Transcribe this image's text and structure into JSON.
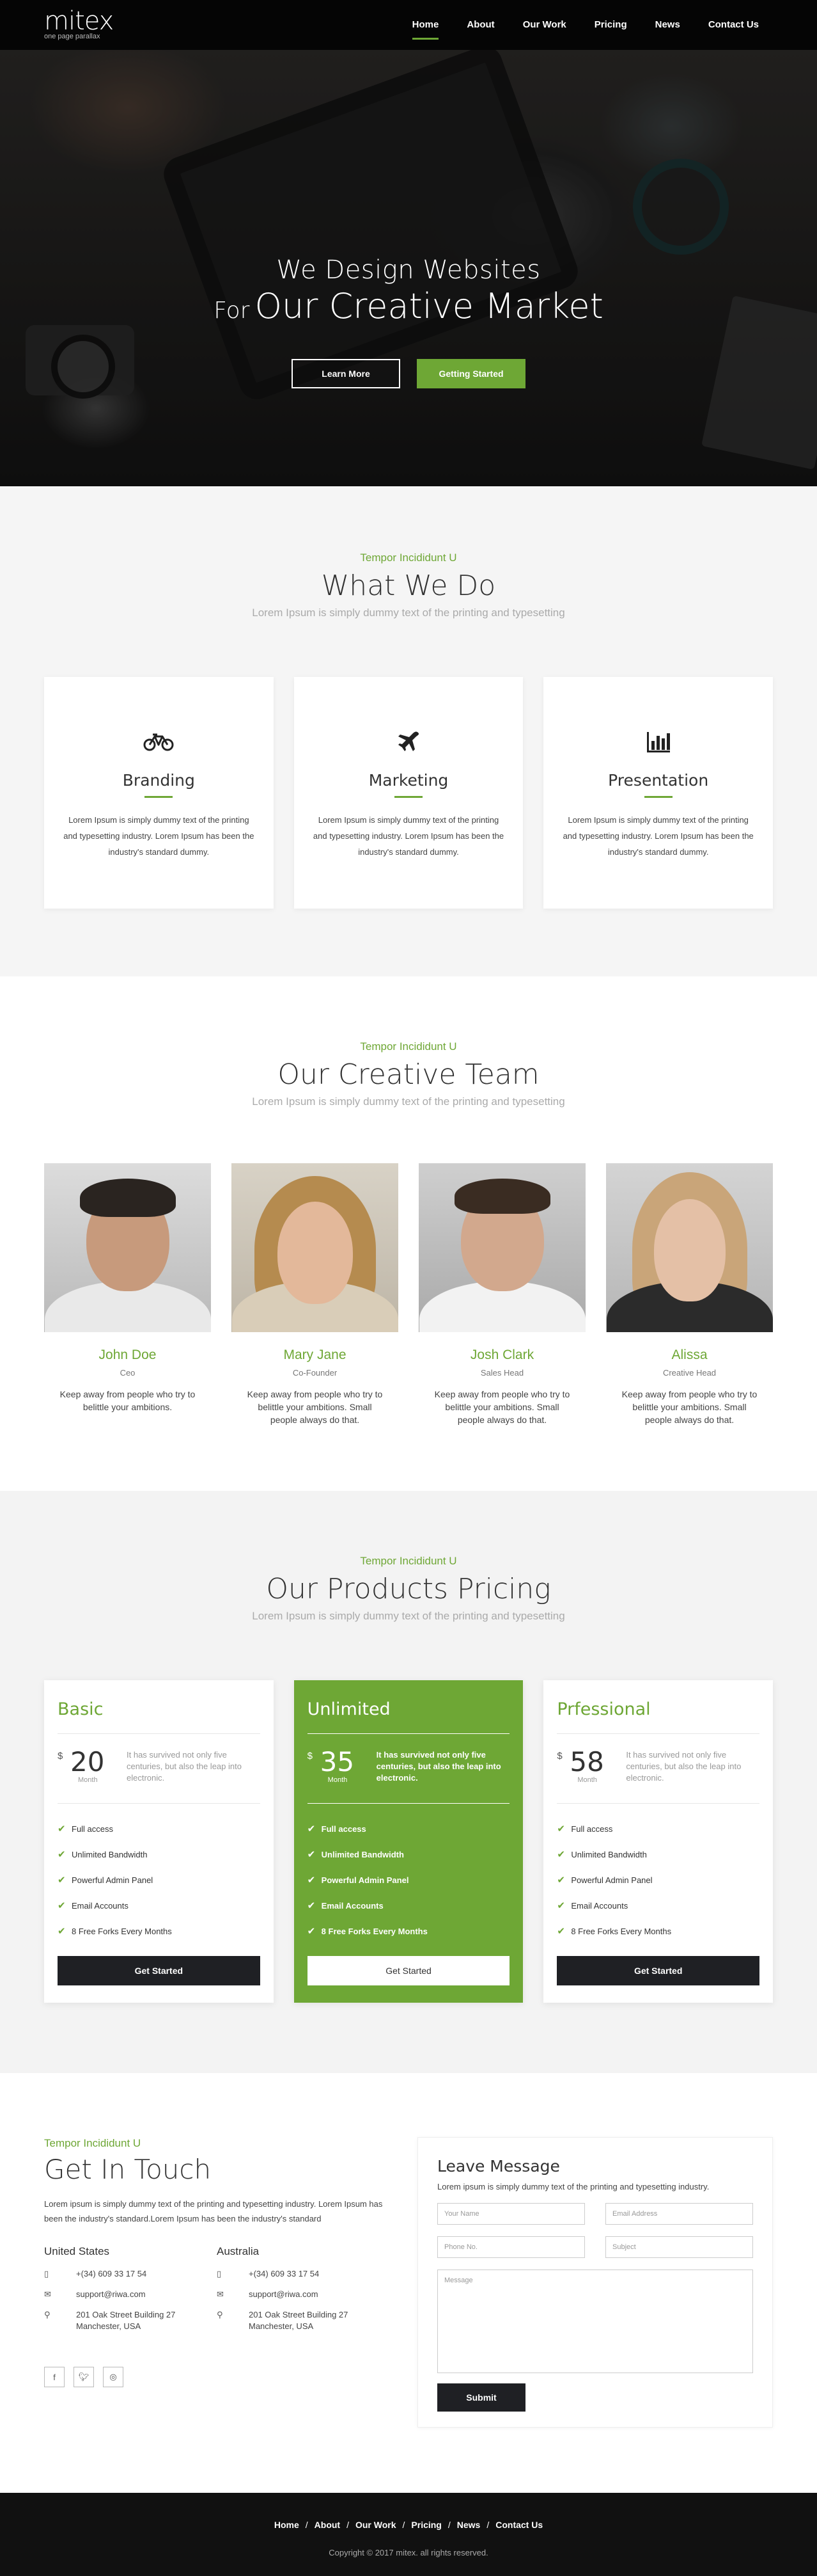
{
  "brand": {
    "name": "mitex",
    "tagline": "one page parallax"
  },
  "nav": {
    "items": [
      "Home",
      "About",
      "Our Work",
      "Pricing",
      "News",
      "Contact Us"
    ]
  },
  "hero": {
    "line1": "We Design Websites",
    "line2_prefix": "For",
    "line2_main": "Our Creative Market",
    "btn_learn": "Learn More",
    "btn_start": "Getting Started"
  },
  "what": {
    "kicker": "Tempor Incididunt U",
    "title": "What We Do",
    "subtitle": "Lorem Ipsum is simply dummy text of the printing and typesetting",
    "cards": [
      {
        "icon": "bicycle-icon",
        "title": "Branding",
        "text": "Lorem Ipsum is simply dummy text of the printing and typesetting industry. Lorem Ipsum has been the industry's standard dummy."
      },
      {
        "icon": "plane-icon",
        "title": "Marketing",
        "text": "Lorem Ipsum is simply dummy text of the printing and typesetting industry. Lorem Ipsum has been the industry's standard dummy."
      },
      {
        "icon": "bar-chart-icon",
        "title": "Presentation",
        "text": "Lorem Ipsum is simply dummy text of the printing and typesetting industry. Lorem Ipsum has been the industry's standard dummy."
      }
    ]
  },
  "team": {
    "kicker": "Tempor Incididunt U",
    "title": "Our Creative Team",
    "subtitle": "Lorem Ipsum is simply dummy text of the printing and typesetting",
    "members": [
      {
        "name": "John Doe",
        "role": "Ceo",
        "text": "Keep away from people who try to belittle your ambitions."
      },
      {
        "name": "Mary Jane",
        "role": "Co-Founder",
        "text": "Keep away from people who try to belittle your ambitions. Small people always do that."
      },
      {
        "name": "Josh Clark",
        "role": "Sales Head",
        "text": "Keep away from people who try to belittle your ambitions. Small people always do that."
      },
      {
        "name": "Alissa",
        "role": "Creative Head",
        "text": "Keep away from people who try to belittle your ambitions. Small people always do that."
      }
    ]
  },
  "pricing": {
    "kicker": "Tempor Incididunt U",
    "title": "Our Products Pricing",
    "subtitle": "Lorem Ipsum is simply dummy text of the printing and typesetting",
    "currency": "$",
    "features": [
      "Full access",
      "Unlimited Bandwidth",
      "Powerful Admin Panel",
      "Email Accounts",
      "8 Free Forks Every Months"
    ],
    "button": "Get Started",
    "plans": [
      {
        "name": "Basic",
        "price": "20",
        "period": "Month",
        "desc": "It has survived not only five centuries, but also the leap into electronic."
      },
      {
        "name": "Unlimited",
        "price": "35",
        "period": "Month",
        "desc": "It has survived not only five centuries, but also the leap into electronic."
      },
      {
        "name": "Prfessional",
        "price": "58",
        "period": "Month",
        "desc": "It has survived not only five centuries, but also the leap into electronic."
      }
    ]
  },
  "contact": {
    "kicker": "Tempor Incididunt U",
    "title": "Get In Touch",
    "intro": "Lorem ipsum is simply dummy text of the printing and typesetting industry. Lorem Ipsum has been the industry's standard.Lorem Ipsum has been the industry's standard",
    "offices": [
      {
        "name": "United States",
        "phone": "+(34) 609 33 17 54",
        "email": "support@riwa.com",
        "address": "201 Oak Street Building 27 Manchester, USA"
      },
      {
        "name": "Australia",
        "phone": "+(34) 609 33 17 54",
        "email": "support@riwa.com",
        "address": "201 Oak Street Building 27 Manchester, USA"
      }
    ],
    "form": {
      "title": "Leave Message",
      "subtitle": "Lorem ipsum is simply dummy text of the printing and typesetting industry.",
      "name_ph": "Your Name",
      "email_ph": "Email Address",
      "phone_ph": "Phone No.",
      "subject_ph": "Subject",
      "message_ph": "Message",
      "submit": "Submit"
    }
  },
  "footer": {
    "links": [
      "Home",
      "About",
      "Our Work",
      "Pricing",
      "News",
      "Contact Us"
    ],
    "separator": "/",
    "copyright": "Copyright © 2017 mitex. all rights reserved."
  },
  "colors": {
    "accent": "#6ea735",
    "dark": "#1f2024",
    "footer": "#111111"
  }
}
